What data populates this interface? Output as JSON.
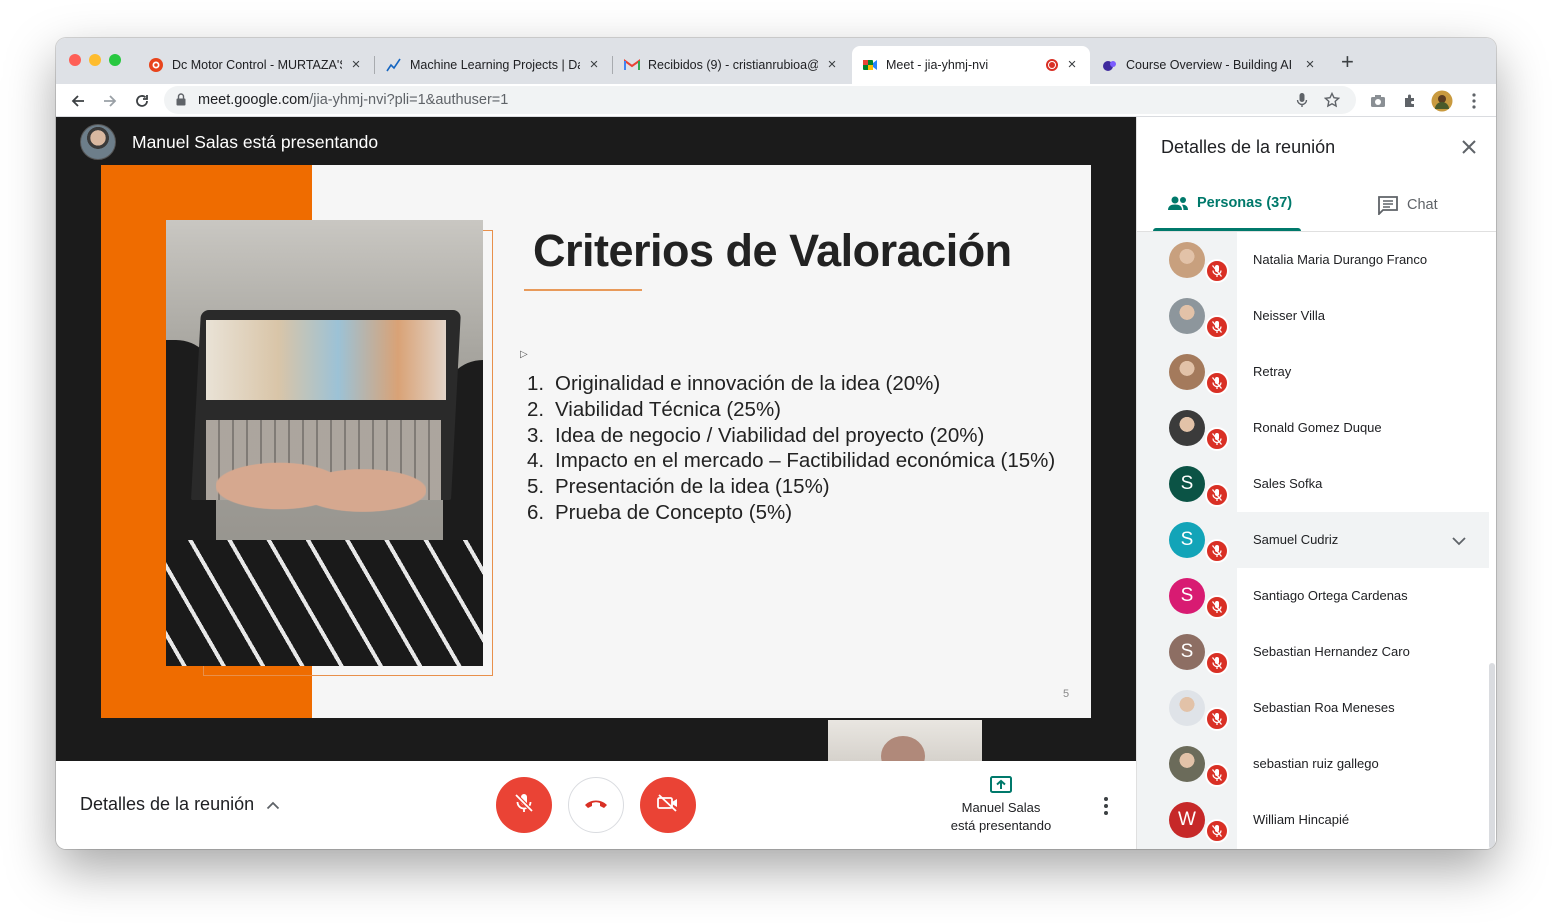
{
  "browser": {
    "tabs": [
      {
        "title": "Dc Motor Control - MURTAZA'S",
        "icon": "tab-favicon-murtaza"
      },
      {
        "title": "Machine Learning Projects | Da",
        "icon": "tab-favicon-chart"
      },
      {
        "title": "Recibidos (9) - cristianrubioa@",
        "icon": "gmail-icon"
      },
      {
        "title": "Meet - jia-yhmj-nvi",
        "icon": "meet-icon"
      },
      {
        "title": "Course Overview - Building AI",
        "icon": "course-icon"
      }
    ],
    "new_tab_label": "+",
    "url_host": "meet.google.com",
    "url_path": "/jia-yhmj-nvi?pli=1&authuser=1"
  },
  "meet": {
    "presenter_text": "Manuel Salas está presentando",
    "slide": {
      "title": "Criterios de Valoración",
      "items": [
        {
          "num": "1.",
          "text": "Originalidad e innovación de la idea (20%)"
        },
        {
          "num": "2.",
          "text": "Viabilidad Técnica (25%)"
        },
        {
          "num": "3.",
          "text": "Idea de negocio / Viabilidad del proyecto (20%)"
        },
        {
          "num": "4.",
          "text": "Impacto en el mercado – Factibilidad económica (15%)"
        },
        {
          "num": "5.",
          "text": "Presentación de la idea (15%)"
        },
        {
          "num": "6.",
          "text": "Prueba de Concepto (5%)"
        }
      ],
      "page_number": "5"
    },
    "bottom": {
      "details_label": "Detalles de la reunión",
      "present_line1": "Manuel Salas",
      "present_line2": "está presentando"
    }
  },
  "panel": {
    "title": "Detalles de la reunión",
    "tab_people": "Personas (37)",
    "tab_chat": "Chat",
    "people": [
      {
        "name": "Natalia Maria Durango Franco",
        "initial": "",
        "color": "#c8a07e"
      },
      {
        "name": "Neisser Villa",
        "initial": "",
        "color": "#8d969c"
      },
      {
        "name": "Retray",
        "initial": "",
        "color": "#a47a5c"
      },
      {
        "name": "Ronald Gomez Duque",
        "initial": "",
        "color": "#3b3b3b"
      },
      {
        "name": "Sales Sofka",
        "initial": "S",
        "color": "#0b5345"
      },
      {
        "name": "Samuel Cudriz",
        "initial": "S",
        "color": "#12a4b8"
      },
      {
        "name": "Santiago Ortega Cardenas",
        "initial": "S",
        "color": "#d81b72"
      },
      {
        "name": "Sebastian Hernandez Caro",
        "initial": "S",
        "color": "#8d6e63"
      },
      {
        "name": "Sebastian Roa Meneses",
        "initial": "",
        "color": "#dfe3e8"
      },
      {
        "name": "sebastian ruiz gallego",
        "initial": "",
        "color": "#6b6b5a"
      },
      {
        "name": "William Hincapié",
        "initial": "W",
        "color": "#c62828"
      }
    ]
  },
  "colors": {
    "meet_red": "#ea4335",
    "meet_teal": "#00796b",
    "slide_orange": "#ef6c00"
  }
}
